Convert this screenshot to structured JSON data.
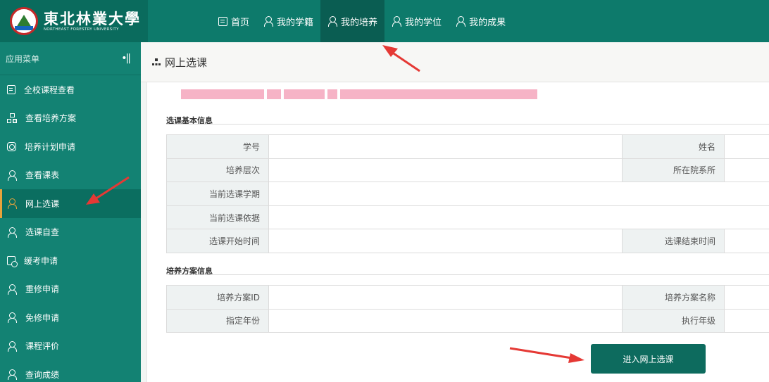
{
  "header": {
    "logo_cn": "東北林業大學",
    "logo_en": "NORTHEAST FORESTRY UNIVERSITY",
    "nav": [
      {
        "label": "首页",
        "icon": "home-icon",
        "active": false
      },
      {
        "label": "我的学籍",
        "icon": "person-icon",
        "active": false
      },
      {
        "label": "我的培养",
        "icon": "person-icon",
        "active": true
      },
      {
        "label": "我的学位",
        "icon": "person-icon",
        "active": false
      },
      {
        "label": "我的成果",
        "icon": "person-icon",
        "active": false
      }
    ]
  },
  "sidebar": {
    "title": "应用菜单",
    "collapse_glyph": "•||",
    "items": [
      {
        "label": "全校课程查看",
        "icon": "document-icon"
      },
      {
        "label": "查看培养方案",
        "icon": "sitemap-icon"
      },
      {
        "label": "培养计划申请",
        "icon": "form-icon"
      },
      {
        "label": "查看课表",
        "icon": "person-icon"
      },
      {
        "label": "网上选课",
        "icon": "person-icon",
        "active": true
      },
      {
        "label": "选课自查",
        "icon": "person-icon"
      },
      {
        "label": "缓考申请",
        "icon": "calendar-icon"
      },
      {
        "label": "重修申请",
        "icon": "person-icon"
      },
      {
        "label": "免修申请",
        "icon": "person-icon"
      },
      {
        "label": "课程评价",
        "icon": "person-icon"
      },
      {
        "label": "查询成绩",
        "icon": "person-icon"
      }
    ]
  },
  "main": {
    "page_title": "网上选课",
    "section1": {
      "title": "选课基本信息",
      "rows": [
        {
          "label": "学号",
          "value": "",
          "label2": "姓名",
          "value2": ""
        },
        {
          "label": "培养层次",
          "value": "",
          "label2": "所在院系所",
          "value2": ""
        },
        {
          "label": "当前选课学期",
          "value": ""
        },
        {
          "label": "当前选课依据",
          "value": ""
        },
        {
          "label": "选课开始时间",
          "value": "",
          "label2": "选课结束时间",
          "value2": ""
        }
      ]
    },
    "section2": {
      "title": "培养方案信息",
      "rows": [
        {
          "label": "培养方案ID",
          "value": "",
          "label2": "培养方案名称",
          "value2": ""
        },
        {
          "label": "指定年份",
          "value": "",
          "label2": "执行年级",
          "value2": ""
        }
      ]
    },
    "enter_button": "进入网上选课"
  },
  "colors": {
    "header_bg": "#0d7a6b",
    "sidebar_bg": "#138273",
    "active_accent": "#e8a33b",
    "button_bg": "#0d6b5e",
    "annotation_red": "#e53935"
  }
}
